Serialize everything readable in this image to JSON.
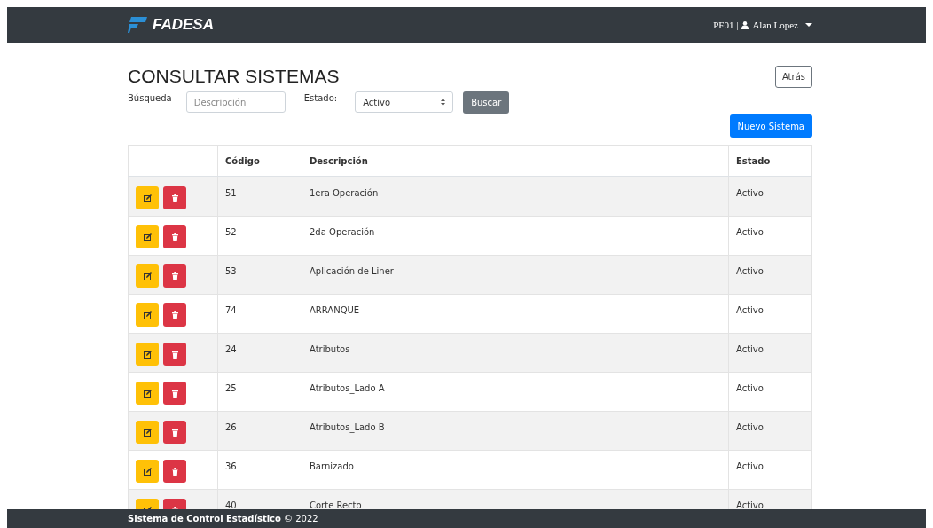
{
  "navbar": {
    "brand": "FADESA",
    "user_code": "PF01 |",
    "user_name": "Alan Lopez"
  },
  "page": {
    "title": "CONSULTAR SISTEMAS",
    "back_button": "Atrás",
    "new_button": "Nuevo Sistema"
  },
  "filters": {
    "search_label": "Búsqueda",
    "search_placeholder": "Descripción",
    "status_label": "Estado:",
    "status_value": "Activo",
    "search_button": "Buscar"
  },
  "table": {
    "columns": [
      "",
      "Código",
      "Descripción",
      "Estado"
    ],
    "rows": [
      {
        "code": "51",
        "description": "1era Operación",
        "status": "Activo"
      },
      {
        "code": "52",
        "description": "2da Operación",
        "status": "Activo"
      },
      {
        "code": "53",
        "description": "Aplicación de Liner",
        "status": "Activo"
      },
      {
        "code": "74",
        "description": "ARRANQUE",
        "status": "Activo"
      },
      {
        "code": "24",
        "description": "Atributos",
        "status": "Activo"
      },
      {
        "code": "25",
        "description": "Atributos_Lado A",
        "status": "Activo"
      },
      {
        "code": "26",
        "description": "Atributos_Lado B",
        "status": "Activo"
      },
      {
        "code": "36",
        "description": "Barnizado",
        "status": "Activo"
      },
      {
        "code": "40",
        "description": "Corte Recto",
        "status": "Activo"
      }
    ]
  },
  "footer": "**Sistema de Control Estadístico** © 2022"
}
